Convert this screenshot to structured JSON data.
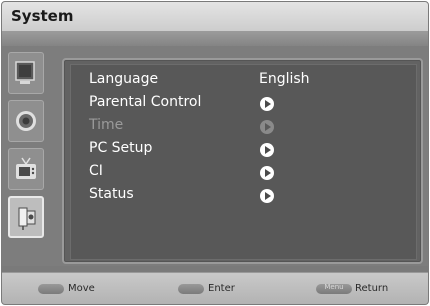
{
  "window": {
    "title": "System"
  },
  "sidebar": {
    "icons": [
      {
        "name": "picture-icon"
      },
      {
        "name": "sound-icon"
      },
      {
        "name": "channel-icon"
      },
      {
        "name": "system-icon",
        "selected": true
      }
    ]
  },
  "menu": {
    "items": [
      {
        "label": "Language",
        "value": "English"
      },
      {
        "label": "Parental Control"
      },
      {
        "label": "Time",
        "disabled": true
      },
      {
        "label": "PC Setup"
      },
      {
        "label": "CI"
      },
      {
        "label": "Status"
      }
    ]
  },
  "footer": {
    "move": {
      "key": "",
      "label": "Move"
    },
    "enter": {
      "key": "",
      "label": "Enter"
    },
    "return": {
      "key": "Menu",
      "label": "Return"
    }
  }
}
